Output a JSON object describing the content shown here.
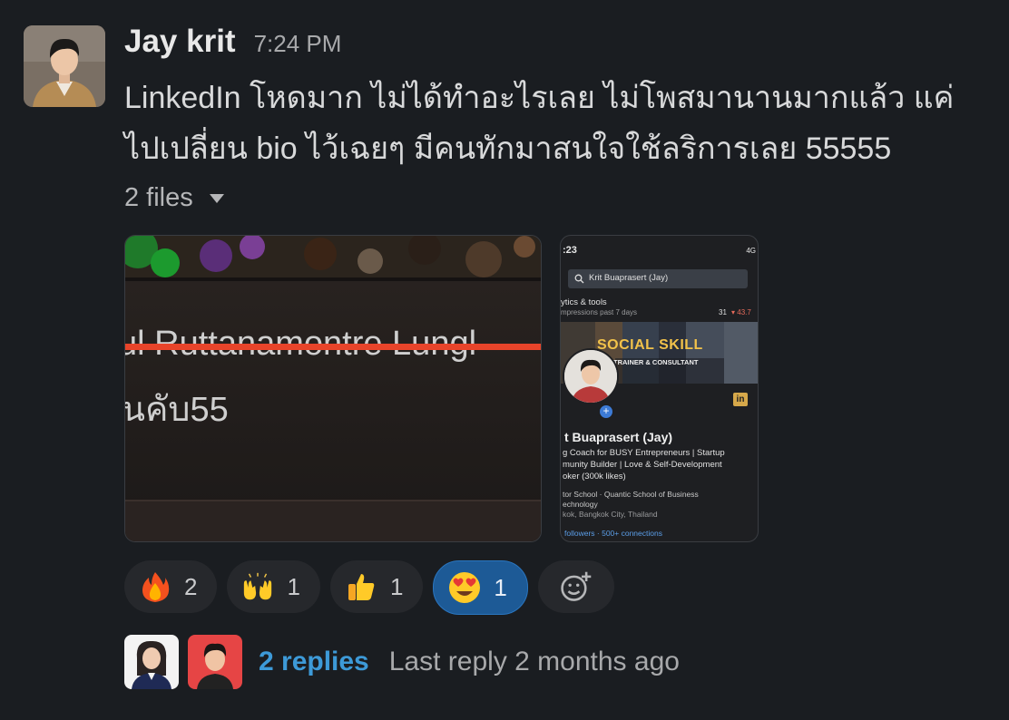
{
  "message": {
    "author": "Jay krit",
    "time": "7:24 PM",
    "text_line1": "LinkedIn โหดมาก ไม่ได้ทำอะไรเลย ไม่โพสมานานมากแล้ว แค่",
    "text_line2": "ไปเปลี่ยน bio ไว้เฉยๆ มีคนทักมาสนใจใช้ลริการเลย 55555"
  },
  "files": {
    "label": "2 files",
    "file1": {
      "text_struck": "ul Ruttanamontre Lungl",
      "text_below": "นคับ55"
    },
    "file2": {
      "status_time": ":23",
      "signal": "4G",
      "search": "Krit Buaprasert (Jay)",
      "analytics_title": "ytics & tools",
      "analytics_sub": "mpressions past 7 days",
      "analytics_num": "31",
      "analytics_change": "▾ 43.7",
      "banner_title": "SOCIAL SKILL",
      "banner_sub": "TRAINER & CONSULTANT",
      "li_badge": "in",
      "name": "t Buaprasert (Jay)",
      "headline1": "g Coach for BUSY Entrepreneurs | Startup",
      "headline2": "munity Builder | Love & Self-Development",
      "headline3": "oker (300k likes)",
      "edu1": "tor School · Quantic School of Business",
      "edu2": "echnology",
      "location": "kok, Bangkok City, Thailand",
      "connections": "followers · 500+ connections"
    }
  },
  "reactions": [
    {
      "icon": "fire-icon",
      "count": "2"
    },
    {
      "icon": "raised-hands-icon",
      "count": "1"
    },
    {
      "icon": "thumbs-up-icon",
      "count": "1"
    },
    {
      "icon": "heart-eyes-icon",
      "count": "1",
      "active": true
    }
  ],
  "thread": {
    "replies": "2 replies",
    "last_reply": "Last reply 2 months ago"
  },
  "colors": {
    "background": "#1a1d21",
    "link": "#3d9ad8",
    "active_reaction": "#1d5a96",
    "strike": "#e8442a"
  }
}
